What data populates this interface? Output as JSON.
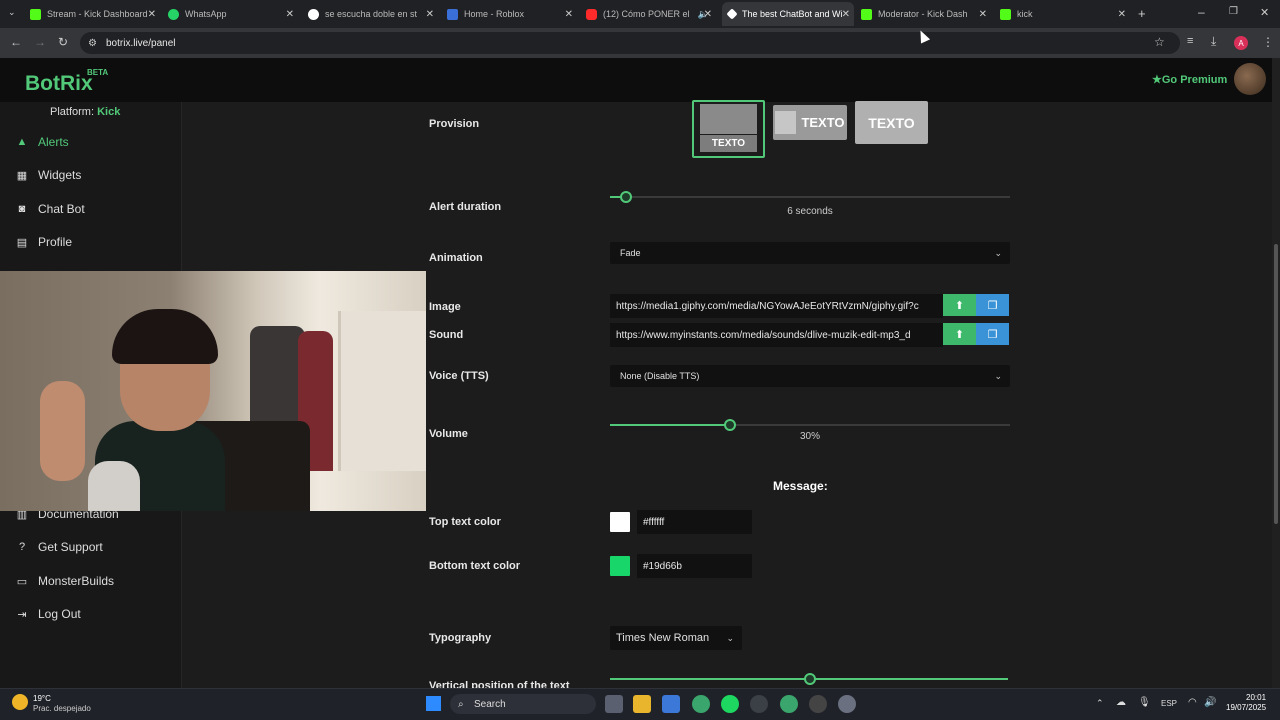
{
  "browser": {
    "tabs": [
      {
        "title": "Stream - Kick Dashboard",
        "active": false
      },
      {
        "title": "WhatsApp",
        "active": false
      },
      {
        "title": "se escucha doble en strea",
        "active": false
      },
      {
        "title": "Home - Roblox",
        "active": false
      },
      {
        "title": "(12) Cómo PONER el",
        "active": false
      },
      {
        "title": "The best ChatBot and Wi",
        "active": true
      },
      {
        "title": "Moderator - Kick Dashbo",
        "active": false
      },
      {
        "title": "kick",
        "active": false
      }
    ],
    "url": "botrix.live/panel",
    "profile_initial": "A"
  },
  "app": {
    "logo": "BotRix",
    "beta": "BETA",
    "premium": "Go Premium"
  },
  "sidebar": {
    "platform_label": "Platform:",
    "platform_value": "Kick",
    "items": [
      {
        "label": "Alerts",
        "icon": "warning-icon",
        "active": true
      },
      {
        "label": "Widgets",
        "icon": "grid-icon",
        "active": false
      },
      {
        "label": "Chat Bot",
        "icon": "robot-icon",
        "active": false
      },
      {
        "label": "Profile",
        "icon": "id-card-icon",
        "active": false
      },
      {
        "label": "Documentation",
        "icon": "book-icon",
        "active": false
      },
      {
        "label": "Get Support",
        "icon": "question-icon",
        "active": false
      },
      {
        "label": "MonsterBuilds",
        "icon": "laptop-icon",
        "active": false
      },
      {
        "label": "Log Out",
        "icon": "logout-icon",
        "active": false
      }
    ]
  },
  "form": {
    "provision": {
      "label": "Provision",
      "options": [
        "TEXTO",
        "TEXTO",
        "TEXTO"
      ]
    },
    "alert_duration": {
      "label": "Alert duration",
      "value_text": "6 seconds",
      "fraction": 0.04
    },
    "animation": {
      "label": "Animation",
      "value": "Fade"
    },
    "image": {
      "label": "Image",
      "value": "https://media1.giphy.com/media/NGYowAJeEotYRtVzmN/giphy.gif?c"
    },
    "sound": {
      "label": "Sound",
      "value": "https://www.myinstants.com/media/sounds/dlive-muzik-edit-mp3_d"
    },
    "voice": {
      "label": "Voice (TTS)",
      "value": "None (Disable TTS)"
    },
    "volume": {
      "label": "Volume",
      "value_text": "30%",
      "fraction": 0.3
    },
    "message_heading": "Message:",
    "top_text_color": {
      "label": "Top text color",
      "value": "#ffffff"
    },
    "bottom_text_color": {
      "label": "Bottom text color",
      "value": "#19d66b"
    },
    "typography": {
      "label": "Typography",
      "value": "Times New Roman"
    },
    "vertical_position": {
      "label": "Vertical position of the text",
      "fraction": 0.5
    }
  },
  "taskbar": {
    "weather_temp": "19°C",
    "weather_desc": "Prac. despejado",
    "search": "Search",
    "lang": "ESP",
    "time": "20:01",
    "date": "19/07/2025"
  },
  "colors": {
    "accent": "#52c879",
    "kick_green": "#53fc18"
  }
}
